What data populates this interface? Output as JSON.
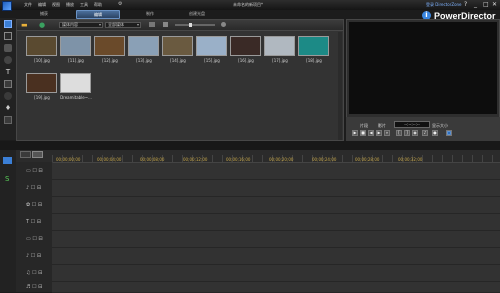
{
  "menu": [
    "文件",
    "编辑",
    "视图",
    "播放",
    "工具",
    "帮助"
  ],
  "window_title": "未命名的新项目*",
  "brand": "PowerDirector",
  "sign_in": "登录 DirectorZone",
  "window_controls": [
    "?",
    "_",
    "□",
    "✕"
  ],
  "mode_tabs": [
    "捕获",
    "编辑",
    "制作",
    "创建光盘"
  ],
  "library": {
    "filter_value": "媒体内容",
    "sort_value": "全部媒体",
    "items": [
      {
        "label": "[10].jpg",
        "color": "#5a4a30"
      },
      {
        "label": "[11].jpg",
        "color": "#7e93a8"
      },
      {
        "label": "[12].jpg",
        "color": "#6a4a2a"
      },
      {
        "label": "[13].jpg",
        "color": "#8aa0b6"
      },
      {
        "label": "[14].jpg",
        "color": "#6a5a40"
      },
      {
        "label": "[15].jpg",
        "color": "#9ab0c8"
      },
      {
        "label": "[16].jpg",
        "color": "#3a2a26"
      },
      {
        "label": "[17].jpg",
        "color": "#b0b8c0"
      },
      {
        "label": "[18].jpg",
        "color": "#1c8a86"
      },
      {
        "label": "[19].jpg",
        "color": "#4a3020"
      },
      {
        "label": "Dreamitable~...",
        "color": "#dddddd"
      }
    ]
  },
  "preview": {
    "tab_clip": "片段",
    "tab_movie": "影片",
    "timecode": "--:--:--:--",
    "quality": "显示大小"
  },
  "timeline": {
    "ticks": [
      "00;00;00;00",
      "00;00;04;00",
      "00;00;08;00",
      "00;00;12;00",
      "00;00;16;00",
      "00;00;20;00",
      "00;00;24;00",
      "00;00;28;00",
      "00;00;32;00"
    ],
    "tracks": [
      {
        "num": "1"
      },
      {
        "num": ""
      },
      {
        "num": ""
      },
      {
        "num": ""
      },
      {
        "num": "2"
      },
      {
        "num": ""
      },
      {
        "num": ""
      },
      {
        "num": ""
      }
    ]
  }
}
